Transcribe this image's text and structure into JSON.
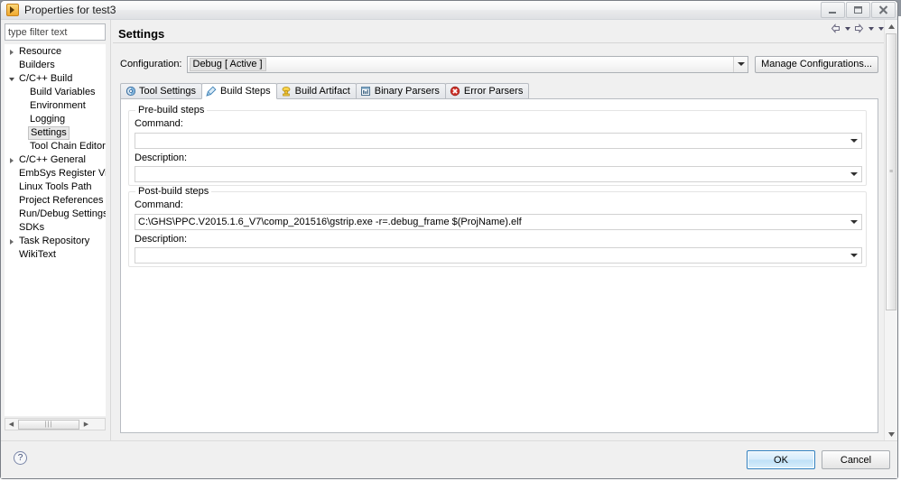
{
  "window": {
    "title": "Properties for test3",
    "app_icon": "eclipse-properties-icon",
    "minimize": "minimize-icon",
    "maximize": "maximize-icon",
    "close": "close-icon"
  },
  "filter": {
    "placeholder": "type filter text",
    "value": ""
  },
  "tree": {
    "items": [
      {
        "label": "Resource",
        "indent": 1,
        "twisty": "collapsed",
        "selected": false
      },
      {
        "label": "Builders",
        "indent": 2,
        "twisty": "none",
        "selected": false
      },
      {
        "label": "C/C++ Build",
        "indent": 1,
        "twisty": "expanded",
        "selected": false
      },
      {
        "label": "Build Variables",
        "indent": 3,
        "twisty": "none",
        "selected": false
      },
      {
        "label": "Environment",
        "indent": 3,
        "twisty": "none",
        "selected": false
      },
      {
        "label": "Logging",
        "indent": 3,
        "twisty": "none",
        "selected": false
      },
      {
        "label": "Settings",
        "indent": 3,
        "twisty": "none",
        "selected": true
      },
      {
        "label": "Tool Chain Editor",
        "indent": 3,
        "twisty": "none",
        "selected": false
      },
      {
        "label": "C/C++ General",
        "indent": 1,
        "twisty": "collapsed",
        "selected": false
      },
      {
        "label": "EmbSys Register Vie",
        "indent": 2,
        "twisty": "none",
        "selected": false
      },
      {
        "label": "Linux Tools Path",
        "indent": 2,
        "twisty": "none",
        "selected": false
      },
      {
        "label": "Project References",
        "indent": 2,
        "twisty": "none",
        "selected": false
      },
      {
        "label": "Run/Debug Settings",
        "indent": 2,
        "twisty": "none",
        "selected": false
      },
      {
        "label": "SDKs",
        "indent": 2,
        "twisty": "none",
        "selected": false
      },
      {
        "label": "Task Repository",
        "indent": 1,
        "twisty": "collapsed",
        "selected": false
      },
      {
        "label": "WikiText",
        "indent": 2,
        "twisty": "none",
        "selected": false
      }
    ]
  },
  "page": {
    "title": "Settings"
  },
  "navigation": {
    "back": "back-arrow-icon",
    "back_menu": "chevron-down-icon",
    "forward": "forward-arrow-icon",
    "forward_menu": "chevron-down-icon",
    "view_menu": "chevron-down-icon"
  },
  "configuration": {
    "label": "Configuration:",
    "value": "Debug  [ Active ]",
    "manage_button": "Manage Configurations..."
  },
  "tabs": [
    {
      "label": "Tool Settings",
      "icon": "tool-settings-icon",
      "active": false
    },
    {
      "label": "Build Steps",
      "icon": "build-steps-icon",
      "active": true
    },
    {
      "label": "Build Artifact",
      "icon": "build-artifact-icon",
      "active": false
    },
    {
      "label": "Binary Parsers",
      "icon": "binary-parsers-icon",
      "active": false
    },
    {
      "label": "Error Parsers",
      "icon": "error-parsers-icon",
      "active": false
    }
  ],
  "build_steps": {
    "prebuild": {
      "group_title": "Pre-build steps",
      "command_label": "Command:",
      "command_value": "",
      "description_label": "Description:",
      "description_value": ""
    },
    "postbuild": {
      "group_title": "Post-build steps",
      "command_label": "Command:",
      "command_value": "C:\\GHS\\PPC.V2015.1.6_V7\\comp_201516\\gstrip.exe -r=.debug_frame $(ProjName).elf",
      "description_label": "Description:",
      "description_value": ""
    }
  },
  "footer": {
    "help": "?",
    "ok": "OK",
    "cancel": "Cancel"
  },
  "colors": {
    "dialog_bg": "#f0f0f0",
    "content_bg": "#ffffff",
    "ok_accent": "#2f7fbf",
    "selection": "#e8e8e8",
    "error_red": "#d0342c"
  }
}
